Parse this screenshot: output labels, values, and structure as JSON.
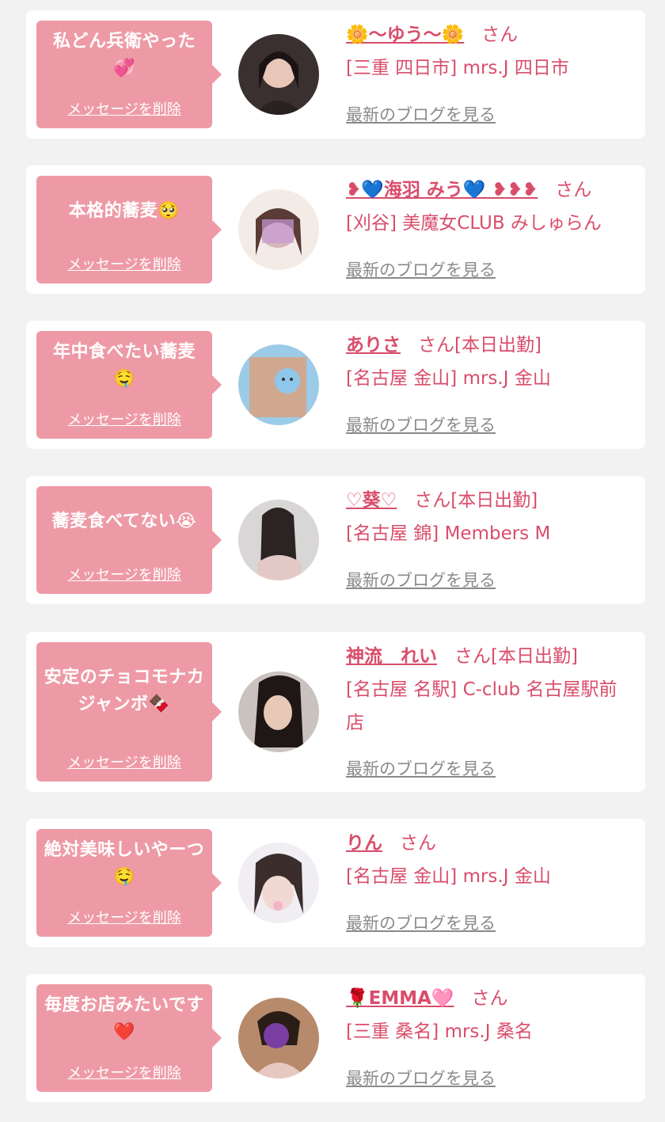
{
  "theme": {
    "accent": "#d94d6a",
    "bubble": "#ee9aa6",
    "card": "#ffffff",
    "background": "#f2f2f2",
    "link_gray": "#8a8a8a"
  },
  "common": {
    "delete_label": "メッセージを削除",
    "blog_label": "最新のブログを見る"
  },
  "entries": [
    {
      "message": "私どん兵衛やった💞",
      "name": "🌼〜ゆう〜🌼",
      "suffix": "さん",
      "shop": "[三重 四日市] mrs.J 四日市"
    },
    {
      "message": "本格的蕎麦🥺",
      "name": "❥💙海羽 みう💙 ❥❥❥",
      "suffix": "さん",
      "shop": "[刈谷] 美魔女CLUB みしゅらん"
    },
    {
      "message": "年中食べたい蕎麦🤤",
      "name": "ありさ",
      "suffix": "さん[本日出勤]",
      "shop": "[名古屋 金山] mrs.J 金山"
    },
    {
      "message": "蕎麦食べてない😭",
      "name": "♡葵♡",
      "suffix": "さん[本日出勤]",
      "shop": "[名古屋 錦] Members M"
    },
    {
      "message": "安定のチョコモナカジャンボ🍫",
      "name": "神流　れい",
      "suffix": "さん[本日出勤]",
      "shop": "[名古屋 名駅] C-club 名古屋駅前店"
    },
    {
      "message": "絶対美味しいやーつ🤤",
      "name": "りん",
      "suffix": "さん",
      "shop": "[名古屋 金山] mrs.J 金山"
    },
    {
      "message": "毎度お店みたいです❤️",
      "name": "🌹EMMA🩷",
      "suffix": "さん",
      "shop": "[三重 桑名] mrs.J 桑名"
    }
  ]
}
